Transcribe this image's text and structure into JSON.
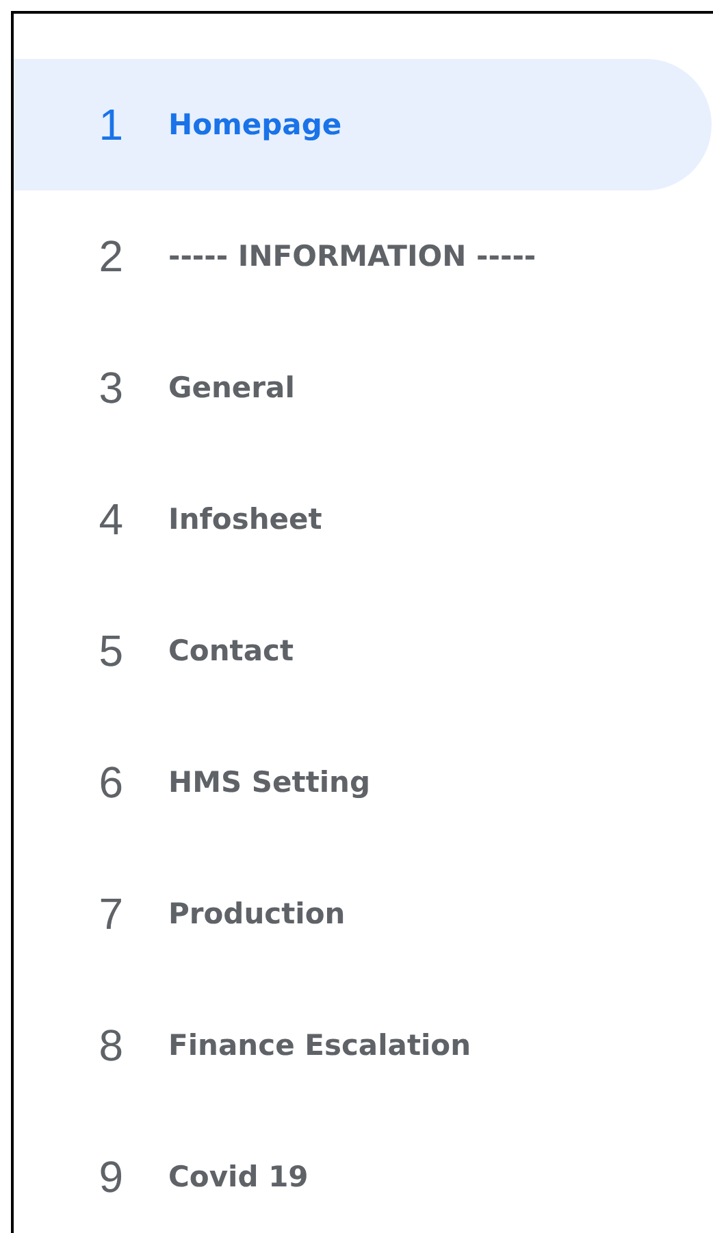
{
  "menu": {
    "items": [
      {
        "number": "1",
        "label": "Homepage",
        "selected": true
      },
      {
        "number": "2",
        "label": "----- INFORMATION -----",
        "selected": false
      },
      {
        "number": "3",
        "label": "General",
        "selected": false
      },
      {
        "number": "4",
        "label": "Infosheet",
        "selected": false
      },
      {
        "number": "5",
        "label": "Contact",
        "selected": false
      },
      {
        "number": "6",
        "label": "HMS Setting",
        "selected": false
      },
      {
        "number": "7",
        "label": "Production",
        "selected": false
      },
      {
        "number": "8",
        "label": "Finance Escalation",
        "selected": false
      },
      {
        "number": "9",
        "label": "Covid 19",
        "selected": false
      }
    ]
  }
}
